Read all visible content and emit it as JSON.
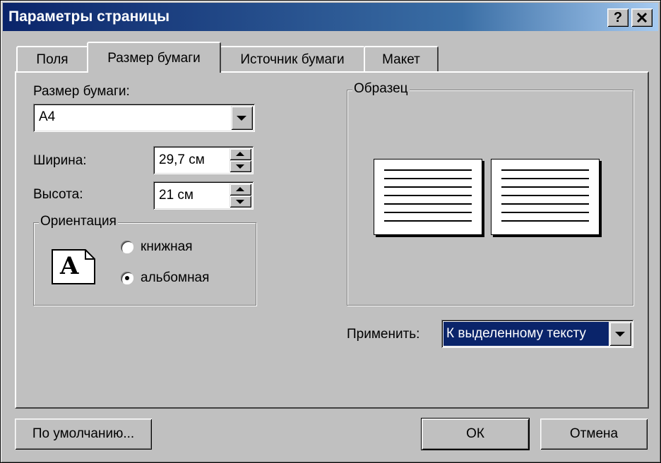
{
  "window": {
    "title": "Параметры страницы",
    "help_label": "?",
    "close_label": "✕"
  },
  "tabs": [
    {
      "label": "Поля",
      "active": false
    },
    {
      "label": "Размер бумаги",
      "active": true
    },
    {
      "label": "Источник бумаги",
      "active": false
    },
    {
      "label": "Макет",
      "active": false
    }
  ],
  "paper_size": {
    "label": "Размер бумаги:",
    "value": "A4"
  },
  "width": {
    "label": "Ширина:",
    "value": "29,7 см"
  },
  "height": {
    "label": "Высота:",
    "value": "21 см"
  },
  "orientation": {
    "title": "Ориентация",
    "icon_letter": "A",
    "portrait_label": "книжная",
    "landscape_label": "альбомная",
    "selected": "landscape"
  },
  "preview": {
    "title": "Образец"
  },
  "apply": {
    "label": "Применить:",
    "value": "К выделенному тексту"
  },
  "buttons": {
    "default_label": "По умолчанию...",
    "ok_label": "ОК",
    "cancel_label": "Отмена"
  },
  "colors": {
    "face": "#c0c0c0",
    "titlebar_start": "#0a246a",
    "titlebar_end": "#a6caf0",
    "selection": "#0a246a"
  }
}
